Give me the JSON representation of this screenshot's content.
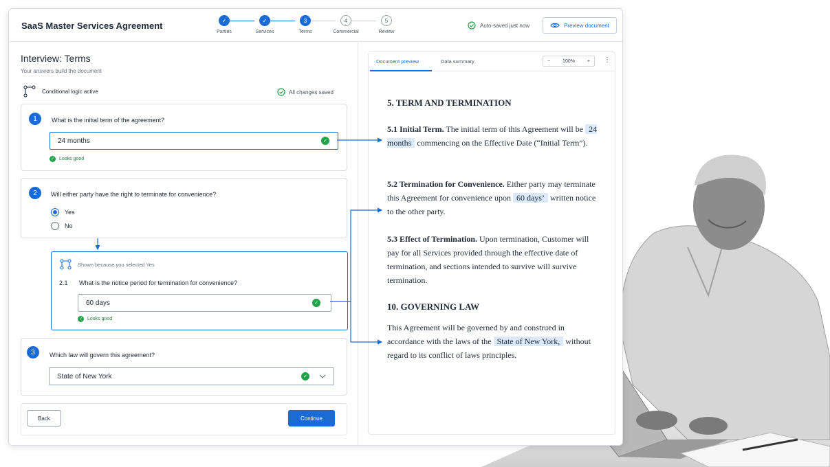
{
  "header": {
    "title": "SaaS Master Services Agreement",
    "steps": [
      {
        "num": "✓",
        "label": "Parties",
        "state": "done"
      },
      {
        "num": "✓",
        "label": "Services",
        "state": "done"
      },
      {
        "num": "3",
        "label": "Terms",
        "state": "current"
      },
      {
        "num": "4",
        "label": "Commercial",
        "state": "todo"
      },
      {
        "num": "5",
        "label": "Review",
        "state": "todo"
      }
    ],
    "autosave": "Auto-saved just now",
    "preview_button": "Preview document"
  },
  "interview": {
    "title": "Interview: Terms",
    "subtitle": "Your answers build the document",
    "logic_label": "Conditional logic active",
    "saved_label": "All changes saved",
    "q1": {
      "num": "1",
      "text": "What is the initial term of the agreement?",
      "value": "24 months",
      "status": "Looks good"
    },
    "q2": {
      "num": "2",
      "text": "Will either party have the right to terminate for convenience?",
      "options": [
        "Yes",
        "No"
      ],
      "selected": "Yes"
    },
    "q21": {
      "shown_label": "Shown because you selected Yes",
      "num": "2.1",
      "text": "What is the notice period for termination for convenience?",
      "value": "60 days",
      "status": "Looks good"
    },
    "q3": {
      "num": "3",
      "text": "Which law will govern this agreement?",
      "value": "State of New York"
    },
    "back_button": "Back",
    "continue_button": "Continue"
  },
  "preview": {
    "tabs": [
      "Document preview",
      "Data summary"
    ],
    "zoom": "100%",
    "zoom_minus": "−",
    "zoom_plus": "+",
    "more": "⋮",
    "section5_title": "5.  TERM AND TERMINATION",
    "s51_heading": "5.1  Initial Term.",
    "s51_a": " The initial term of this Agreement will be",
    "s51_value": "24 months",
    "s51_b": " commencing on the Effective Date (“Initial Term”).",
    "s52_heading": "5.2  Termination for Convenience.",
    "s52_a": " Either party may terminate this Agreement for convenience upon",
    "s52_value": "60 days’",
    "s52_b": " written notice to the other party.",
    "s53_heading": "5.3  Effect of Termination.",
    "s53_a": "  Upon termination, Customer will pay for all Services provided through the effective date of termination, and sections intended to survive will survive termination.",
    "section10_title": "10.  GOVERNING LAW",
    "s10_a": "This Agreement will be governed by and construed in accordance with the laws of the",
    "s10_value": "State of New York,",
    "s10_b": " without regard to its conflict of laws principles."
  },
  "colors": {
    "accent": "#1a6bd6",
    "success": "#22a34a",
    "highlight": "#dbe9fb"
  },
  "icons": [
    "check-circle-icon",
    "eye-icon",
    "branch-icon",
    "chevron-down-icon",
    "kebab-icon"
  ]
}
